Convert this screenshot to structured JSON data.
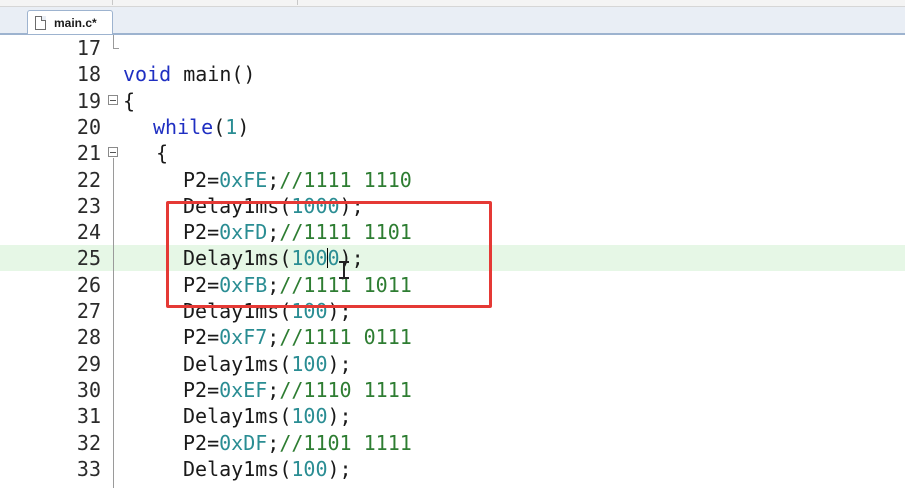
{
  "tab": {
    "label": "main.c*",
    "icon": "file-icon"
  },
  "lines": [
    {
      "num": "17",
      "parts": []
    },
    {
      "num": "18",
      "parts": [
        {
          "t": "void",
          "c": "kw"
        },
        {
          "t": " main()",
          "c": ""
        }
      ]
    },
    {
      "num": "19",
      "parts": [
        {
          "t": "{",
          "c": ""
        }
      ]
    },
    {
      "num": "20",
      "parts": [
        {
          "t": "while",
          "c": "kw"
        },
        {
          "t": "(",
          "c": ""
        },
        {
          "t": "1",
          "c": "num"
        },
        {
          "t": ")",
          "c": ""
        }
      ]
    },
    {
      "num": "21",
      "parts": [
        {
          "t": "{",
          "c": ""
        }
      ]
    },
    {
      "num": "22",
      "parts": [
        {
          "t": "P2=",
          "c": ""
        },
        {
          "t": "0xFE",
          "c": "num"
        },
        {
          "t": ";",
          "c": ""
        },
        {
          "t": "//1111 1110",
          "c": "cm"
        }
      ]
    },
    {
      "num": "23",
      "parts": [
        {
          "t": "Delay1ms(",
          "c": ""
        },
        {
          "t": "1000",
          "c": "num"
        },
        {
          "t": ");",
          "c": ""
        }
      ]
    },
    {
      "num": "24",
      "parts": [
        {
          "t": "P2=",
          "c": ""
        },
        {
          "t": "0xFD",
          "c": "num"
        },
        {
          "t": ";",
          "c": ""
        },
        {
          "t": "//1111 1101",
          "c": "cm"
        }
      ]
    },
    {
      "num": "25",
      "parts": [
        {
          "t": "Delay1ms(",
          "c": ""
        },
        {
          "t": "100",
          "c": "num"
        },
        {
          "t": "|",
          "c": "caret"
        },
        {
          "t": "0",
          "c": "num"
        },
        {
          "t": ");",
          "c": ""
        }
      ]
    },
    {
      "num": "26",
      "parts": [
        {
          "t": "P2=",
          "c": ""
        },
        {
          "t": "0xFB",
          "c": "num"
        },
        {
          "t": ";",
          "c": ""
        },
        {
          "t": "//1111 1011",
          "c": "cm"
        }
      ]
    },
    {
      "num": "27",
      "parts": [
        {
          "t": "Delay1ms(",
          "c": ""
        },
        {
          "t": "100",
          "c": "num"
        },
        {
          "t": ");",
          "c": ""
        }
      ]
    },
    {
      "num": "28",
      "parts": [
        {
          "t": "P2=",
          "c": ""
        },
        {
          "t": "0xF7",
          "c": "num"
        },
        {
          "t": ";",
          "c": ""
        },
        {
          "t": "//1111 0111",
          "c": "cm"
        }
      ]
    },
    {
      "num": "29",
      "parts": [
        {
          "t": "Delay1ms(",
          "c": ""
        },
        {
          "t": "100",
          "c": "num"
        },
        {
          "t": ");",
          "c": ""
        }
      ]
    },
    {
      "num": "30",
      "parts": [
        {
          "t": "P2=",
          "c": ""
        },
        {
          "t": "0xEF",
          "c": "num"
        },
        {
          "t": ";",
          "c": ""
        },
        {
          "t": "//1110 1111",
          "c": "cm"
        }
      ]
    },
    {
      "num": "31",
      "parts": [
        {
          "t": "Delay1ms(",
          "c": ""
        },
        {
          "t": "100",
          "c": "num"
        },
        {
          "t": ");",
          "c": ""
        }
      ]
    },
    {
      "num": "32",
      "parts": [
        {
          "t": "P2=",
          "c": ""
        },
        {
          "t": "0xDF",
          "c": "num"
        },
        {
          "t": ";",
          "c": ""
        },
        {
          "t": "//1101 1111",
          "c": "cm"
        }
      ]
    },
    {
      "num": "33",
      "parts": [
        {
          "t": "Delay1ms(",
          "c": ""
        },
        {
          "t": "100",
          "c": "num"
        },
        {
          "t": ");",
          "c": ""
        }
      ]
    }
  ],
  "colors": {
    "keyword": "#1f2fc2",
    "number": "#2a8d93",
    "comment": "#2e7d32",
    "highlight": "#e6f7e6",
    "annotation_box": "#e53935"
  }
}
